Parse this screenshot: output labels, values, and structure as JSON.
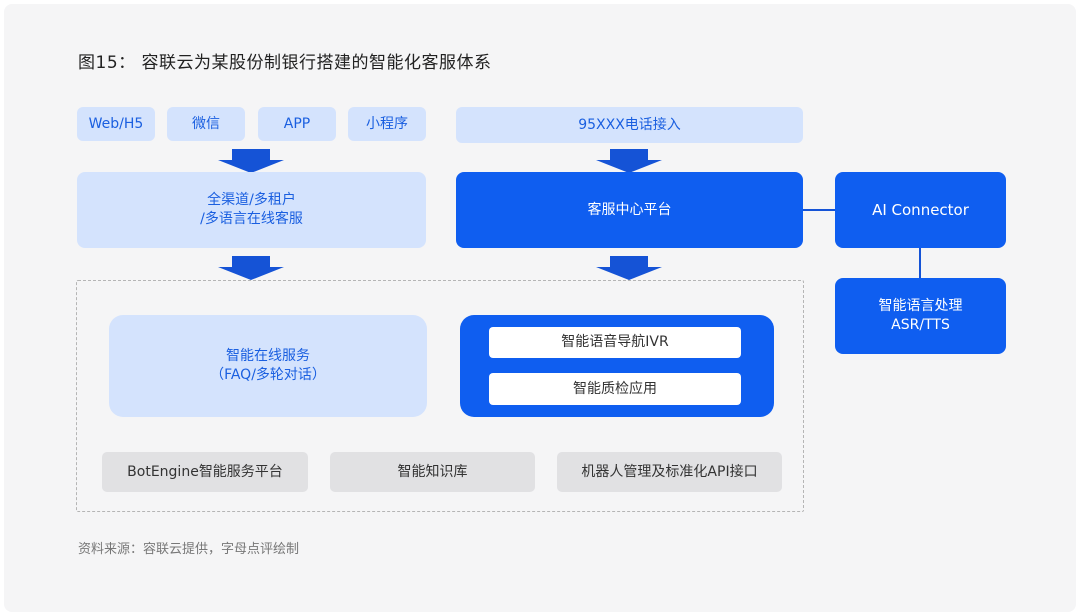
{
  "title": "图15： 容联云为某股份制银行搭建的智能化客服体系",
  "source": "资料来源：容联云提供，字母点评绘制",
  "colors": {
    "primary_blue": "#0f5ef0",
    "light_blue": "#d4e3fd",
    "light_text": "#1a5fe0",
    "arrow_blue": "#1553d6",
    "gray_box": "#e1e1e3"
  },
  "channels": [
    {
      "label": "Web/H5"
    },
    {
      "label": "微信"
    },
    {
      "label": "APP"
    },
    {
      "label": "小程序"
    }
  ],
  "phone_access": "95XXX电话接入",
  "online_service": {
    "line1": "全渠道/多租户",
    "line2": "/多语言在线客服"
  },
  "call_center": "客服中心平台",
  "ai_connector": "AI Connector",
  "nlp": {
    "line1": "智能语言处理",
    "line2": "ASR/TTS"
  },
  "smart_online": {
    "line1": "智能在线服务",
    "line2": "（FAQ/多轮对话）"
  },
  "voice_apps": [
    {
      "label": "智能语音导航IVR"
    },
    {
      "label": "智能质检应用"
    }
  ],
  "platforms": [
    {
      "label": "BotEngine智能服务平台"
    },
    {
      "label": "智能知识库"
    },
    {
      "label": "机器人管理及标准化API接口"
    }
  ]
}
